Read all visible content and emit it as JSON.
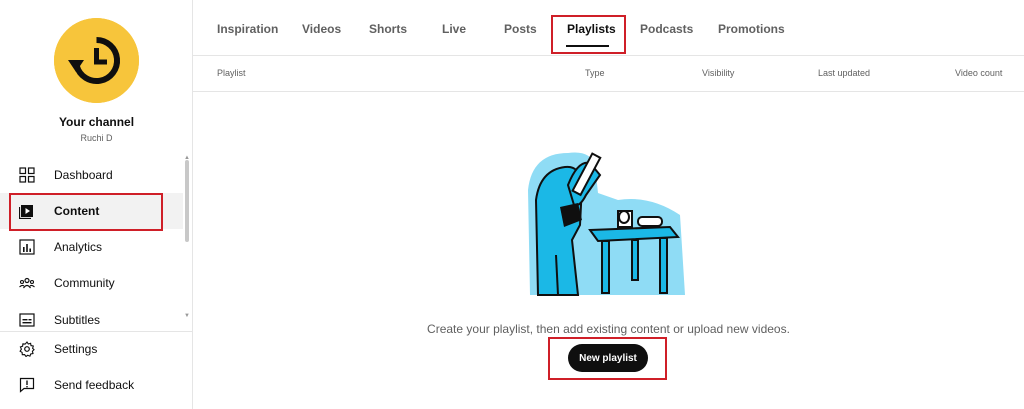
{
  "channel": {
    "title": "Your channel",
    "handle": "Ruchi D",
    "avatar_icon": "history-clock-icon",
    "avatar_color": "#f7c53b"
  },
  "sidebar": {
    "items": [
      {
        "label": "Dashboard",
        "icon": "dashboard-icon"
      },
      {
        "label": "Content",
        "icon": "content-icon",
        "active": true
      },
      {
        "label": "Analytics",
        "icon": "analytics-icon"
      },
      {
        "label": "Community",
        "icon": "community-icon"
      },
      {
        "label": "Subtitles",
        "icon": "subtitles-icon"
      }
    ],
    "footer": [
      {
        "label": "Settings",
        "icon": "gear-icon"
      },
      {
        "label": "Send feedback",
        "icon": "feedback-icon"
      }
    ]
  },
  "tabs": [
    {
      "label": "Inspiration"
    },
    {
      "label": "Videos"
    },
    {
      "label": "Shorts"
    },
    {
      "label": "Live"
    },
    {
      "label": "Posts"
    },
    {
      "label": "Playlists",
      "active": true
    },
    {
      "label": "Podcasts"
    },
    {
      "label": "Promotions"
    }
  ],
  "table": {
    "columns": [
      "Playlist",
      "Type",
      "Visibility",
      "Last updated",
      "Video count"
    ]
  },
  "empty_state": {
    "message": "Create your playlist, then add existing content or upload new videos.",
    "button_label": "New playlist"
  },
  "colors": {
    "highlight": "#cf1f28",
    "illustration_blue": "#1bb8e6",
    "button_bg": "#0f0f0f"
  }
}
